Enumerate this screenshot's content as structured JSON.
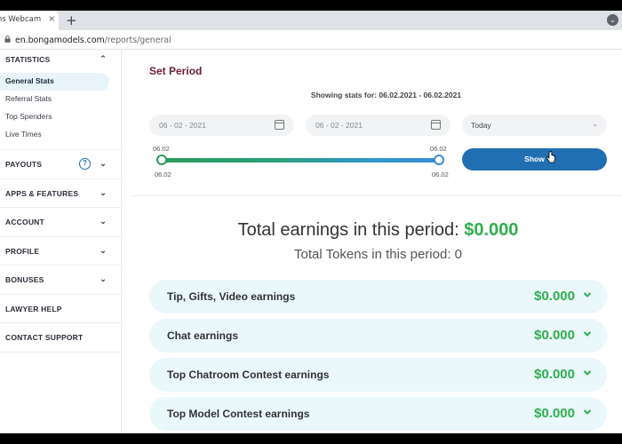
{
  "browser": {
    "tab_title": "ms Webcam",
    "tab_close": "×",
    "new_tab": "+",
    "url_host": "en.bongamodels.com",
    "url_path": "/reports/general"
  },
  "sidebar": {
    "statistics_label": "STATISTICS",
    "statistics_items": [
      {
        "label": "General Stats",
        "active": true
      },
      {
        "label": "Referral Stats"
      },
      {
        "label": "Top Spenders"
      },
      {
        "label": "Live Times"
      }
    ],
    "groups": [
      {
        "label": "PAYOUTS"
      },
      {
        "label": "APPS & FEATURES"
      },
      {
        "label": "ACCOUNT"
      },
      {
        "label": "PROFILE"
      },
      {
        "label": "BONUSES"
      },
      {
        "label": "LAWYER HELP"
      },
      {
        "label": "CONTACT SUPPORT"
      }
    ],
    "help_glyph": "?"
  },
  "period": {
    "title": "Set Period",
    "showing": "Showing stats for: 06.02.2021 - 06.02.2021",
    "date_from": "06 - 02 - 2021",
    "date_to": "06 - 02 - 2021",
    "range_select": "Today",
    "slider_top_left": "06.02",
    "slider_top_right": "06.02",
    "slider_bottom_left": "06.02",
    "slider_bottom_right": "06.02",
    "show_button": "Show"
  },
  "totals": {
    "earnings_label": "Total earnings in this period:",
    "earnings_value": "$0.000",
    "tokens_label": "Total Tokens in this period: 0"
  },
  "earnings_rows": [
    {
      "label": "Tip, Gifts, Video earnings",
      "value": "$0.000"
    },
    {
      "label": "Chat earnings",
      "value": "$0.000"
    },
    {
      "label": "Top Chatroom Contest earnings",
      "value": "$0.000"
    },
    {
      "label": "Top Model Contest earnings",
      "value": "$0.000"
    }
  ],
  "colors": {
    "accent_blue": "#1f6fb2",
    "money_green": "#2eb04d",
    "title_maroon": "#6a1e3a"
  }
}
